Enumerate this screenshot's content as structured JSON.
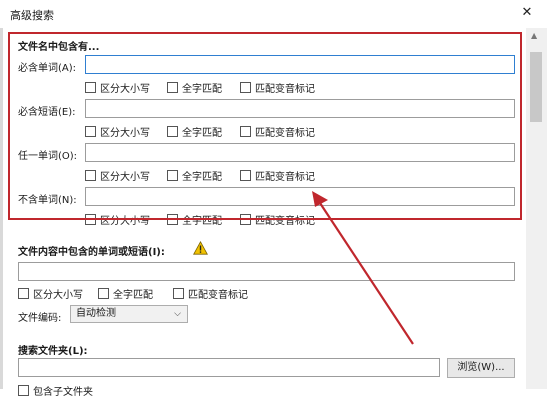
{
  "window": {
    "title": "高级搜索"
  },
  "filename_section": {
    "header": "文件名中包含有...",
    "rows": [
      {
        "label": "必含单词(A):",
        "value": ""
      },
      {
        "label": "必含短语(E):",
        "value": ""
      },
      {
        "label": "任一单词(O):",
        "value": ""
      },
      {
        "label": "不含单词(N):",
        "value": ""
      }
    ],
    "options": [
      "区分大小写",
      "全字匹配",
      "匹配变音标记"
    ]
  },
  "content_section": {
    "header": "文件内容中包含的单词或短语(I):",
    "value": "",
    "options": [
      "区分大小写",
      "全字匹配",
      "匹配变音标记"
    ],
    "encoding_label": "文件编码:",
    "encoding_value": "自动检测"
  },
  "folder_section": {
    "header": "搜索文件夹(L):",
    "value": "",
    "browse_label": "浏览(W)...",
    "include_subfolders": "包含子文件夹"
  },
  "annotation": {
    "highlight_color": "#c0272d"
  },
  "icons": {
    "warning": "warning-icon",
    "close": "close-icon"
  }
}
